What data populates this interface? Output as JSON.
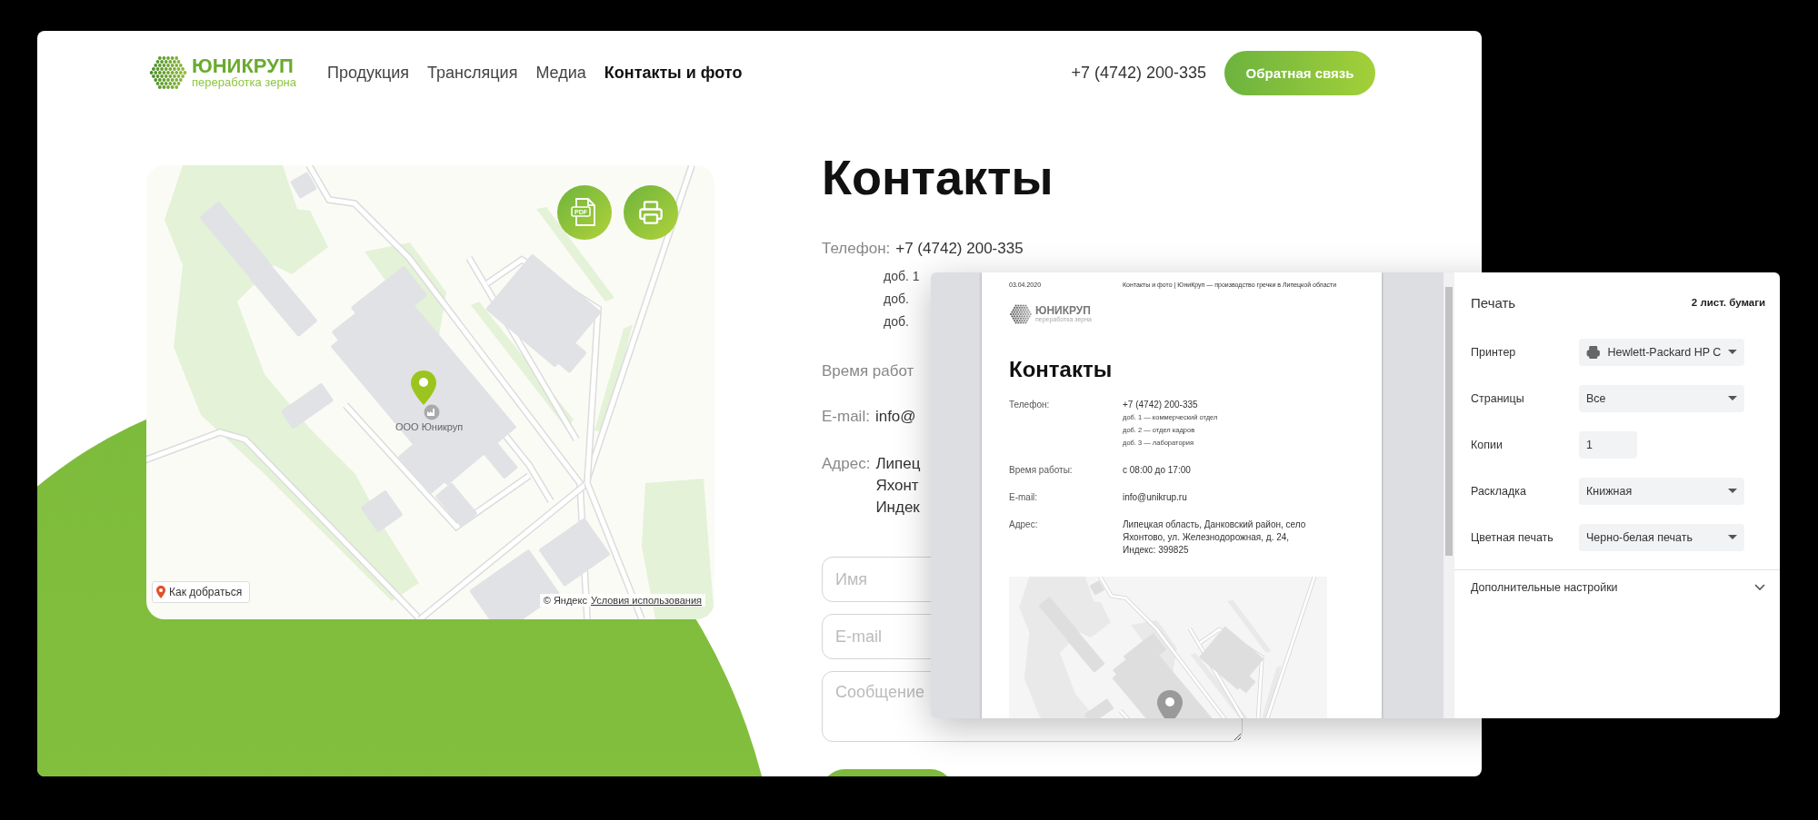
{
  "header": {
    "logo": {
      "name": "ЮНИКРУП",
      "tagline": "переработка зерна"
    },
    "nav": [
      {
        "label": "Продукция",
        "selected": false
      },
      {
        "label": "Трансляция",
        "selected": false
      },
      {
        "label": "Медиа",
        "selected": false
      },
      {
        "label": "Контакты и фото",
        "selected": true
      }
    ],
    "phone": "+7 (4742) 200-335",
    "callback_button": "Обратная связь"
  },
  "map": {
    "place_label": "ООО Юникруп",
    "pdf_label": "PDF",
    "route_button": "Как добраться",
    "copyright": "© Яндекс",
    "terms_link": "Условия использования"
  },
  "contacts": {
    "title": "Контакты",
    "phone": {
      "label": "Телефон:",
      "value": "+7 (4742) 200-335"
    },
    "extensions": [
      "доб. 1",
      "доб.",
      "доб."
    ],
    "hours_label": "Время работ",
    "email": {
      "label": "E-mail:",
      "value": "info@"
    },
    "address": {
      "label": "Адрес:",
      "lines": [
        "Липец",
        "Яхонт",
        "Индек"
      ]
    }
  },
  "form": {
    "fields": [
      {
        "kind": "input",
        "placeholder": "Имя"
      },
      {
        "kind": "input",
        "placeholder": "E-mail"
      },
      {
        "kind": "textarea",
        "placeholder": "Сообщение"
      }
    ]
  },
  "print_dialog": {
    "preview": {
      "date": "03.04.2020",
      "page_title": "Контакты и фото | ЮниКруп — производство гречки в Липецкой области",
      "logo": {
        "name": "ЮНИКРУП",
        "tagline": "переработка зерна"
      },
      "title": "Контакты",
      "rows": [
        {
          "label": "Телефон:",
          "value": "+7 (4742) 200-335",
          "notes": [
            "доб. 1 — коммерческий отдел",
            "доб. 2 — отдел кадров",
            "доб. 3 — лаборатория"
          ]
        },
        {
          "label": "Время работы:",
          "value": "с 08:00 до 17:00"
        },
        {
          "label": "E-mail:",
          "value": "info@unikrup.ru"
        },
        {
          "label": "Адрес:",
          "value": "Липецкая область, Данковский район, село Яхонтово, ул. Железнодорожная, д. 24, Индекс: 399825"
        }
      ]
    },
    "settings": {
      "title": "Печать",
      "sheets": "2 лист. бумаги",
      "options": [
        {
          "label": "Принтер",
          "kind": "printer",
          "value": "Hewlett-Packard HP C"
        },
        {
          "label": "Страницы",
          "kind": "select",
          "value": "Все"
        },
        {
          "label": "Копии",
          "kind": "number",
          "value": "1"
        },
        {
          "label": "Раскладка",
          "kind": "select",
          "value": "Книжная"
        },
        {
          "label": "Цветная печать",
          "kind": "select",
          "value": "Черно-белая печать"
        }
      ],
      "more": {
        "label": "Дополнительные настройки",
        "expanded": false
      }
    }
  }
}
